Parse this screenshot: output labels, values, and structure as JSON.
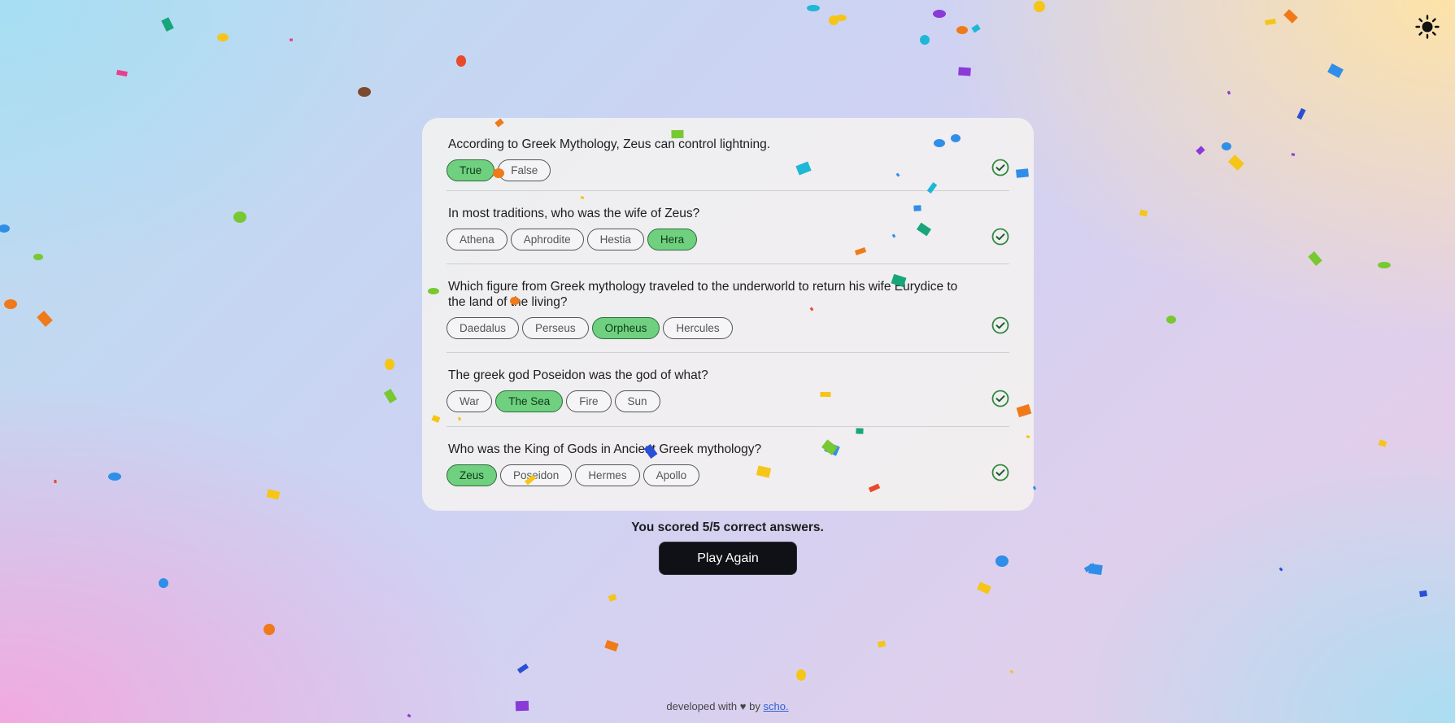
{
  "theme_toggle": {
    "icon": "sun-icon"
  },
  "questions": [
    {
      "text": "According to Greek Mythology, Zeus can control lightning.",
      "options": [
        "True",
        "False"
      ],
      "selected": 0,
      "status": "correct"
    },
    {
      "text": "In most traditions, who was the wife of Zeus?",
      "options": [
        "Athena",
        "Aphrodite",
        "Hestia",
        "Hera"
      ],
      "selected": 3,
      "status": "correct"
    },
    {
      "text": "Which figure from Greek mythology traveled to the underworld to return his wife Eurydice to the land of the living?",
      "options": [
        "Daedalus",
        "Perseus",
        "Orpheus",
        "Hercules"
      ],
      "selected": 2,
      "status": "correct"
    },
    {
      "text": "The greek god Poseidon was the god of what?",
      "options": [
        "War",
        "The Sea",
        "Fire",
        "Sun"
      ],
      "selected": 1,
      "status": "correct"
    },
    {
      "text": "Who was the King of Gods in Ancient Greek mythology?",
      "options": [
        "Zeus",
        "Poseidon",
        "Hermes",
        "Apollo"
      ],
      "selected": 0,
      "status": "correct"
    }
  ],
  "score_text": "You scored 5/5 correct answers.",
  "play_again_label": "Play Again",
  "footer": {
    "prefix": "developed with",
    "heart": "♥",
    "by": "by",
    "link": "scho."
  },
  "colors": {
    "selected_option": "#6fd07f",
    "check": "#2f8a3e",
    "button": "#0f1116"
  }
}
